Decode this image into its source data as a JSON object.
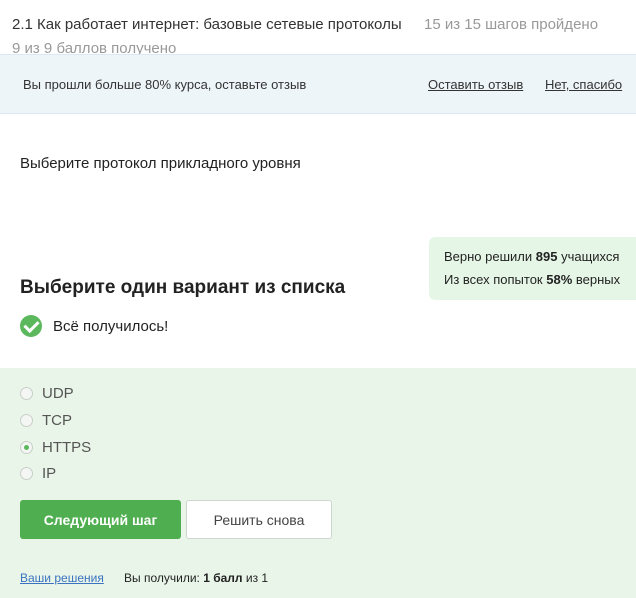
{
  "header": {
    "lesson_title": "2.1 Как работает интернет: базовые сетевые протоколы",
    "steps_passed": "15 из 15 шагов пройдено",
    "score": "9 из 9 баллов  получено"
  },
  "banner": {
    "text": "Вы прошли больше 80% курса, оставьте отзыв",
    "leave_review": "Оставить отзыв",
    "no_thanks": "Нет, спасибо"
  },
  "question": {
    "text": "Выберите протокол прикладного уровня"
  },
  "stats": {
    "solved_prefix": "Верно решили ",
    "solved_count": "895",
    "solved_suffix": " учащихся",
    "attempts_prefix": "Из всех попыток ",
    "attempts_percent": "58%",
    "attempts_suffix": " верных"
  },
  "task": {
    "heading": "Выберите один вариант из списка",
    "success": "Всё получилось!"
  },
  "options": [
    {
      "label": "UDP",
      "selected": false
    },
    {
      "label": "TCP",
      "selected": false
    },
    {
      "label": "HTTPS",
      "selected": true
    },
    {
      "label": "IP",
      "selected": false
    }
  ],
  "buttons": {
    "next": "Следующий шаг",
    "retry": "Решить снова"
  },
  "footer": {
    "your_solutions": "Ваши решения",
    "points_prefix": "Вы получили: ",
    "points_value": "1 балл",
    "points_suffix": " из 1"
  },
  "colors": {
    "accent_green": "#4fae4f",
    "success_green": "#5cb85c",
    "banner_bg": "#eef5f9",
    "panel_bg": "#e9f5e9"
  }
}
